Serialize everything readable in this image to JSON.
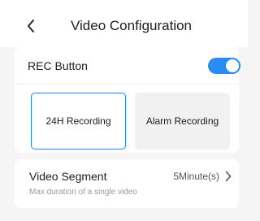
{
  "header": {
    "title": "Video Configuration",
    "back_icon": "chevron-left-icon"
  },
  "rec": {
    "label": "REC Button",
    "toggle_on": true,
    "toggle_color": "#2a8cf3"
  },
  "recording_options": [
    {
      "label": "24H Recording",
      "selected": true
    },
    {
      "label": "Alarm Recording",
      "selected": false
    }
  ],
  "video_segment": {
    "title": "Video Segment",
    "subtitle": "Max duration of a single video",
    "value": "5Minute(s)",
    "chevron_icon": "chevron-right-icon"
  },
  "colors": {
    "accent": "#1f7fe8",
    "background": "#f5f5f5"
  }
}
